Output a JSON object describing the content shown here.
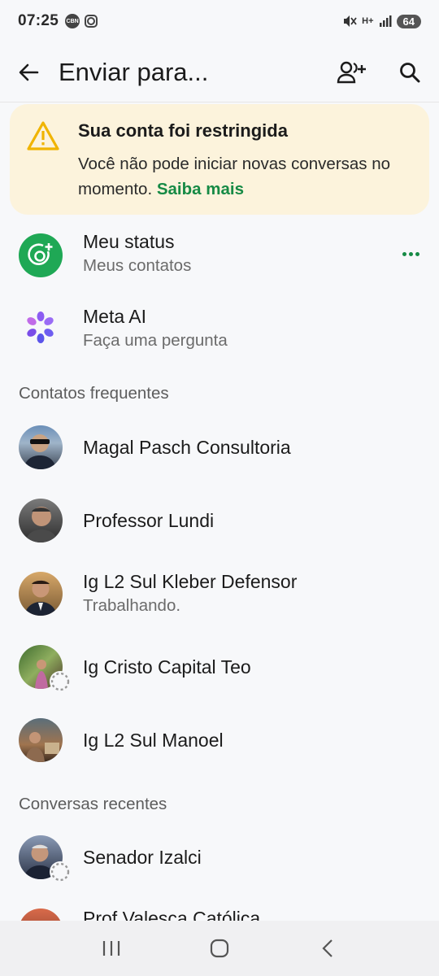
{
  "status_bar": {
    "time": "07:25",
    "notif_icon_1": "CBN",
    "battery": "64",
    "network": "H+"
  },
  "app_bar": {
    "title": "Enviar para..."
  },
  "banner": {
    "title": "Sua conta foi restringida",
    "text": "Você não pode iniciar novas conversas no momento.",
    "link": "Saiba mais"
  },
  "special_rows": [
    {
      "name": "Meu status",
      "sub": "Meus contatos"
    },
    {
      "name": "Meta AI",
      "sub": "Faça uma pergunta"
    }
  ],
  "sections": {
    "frequent": "Contatos frequentes",
    "recent": "Conversas recentes"
  },
  "frequent_contacts": [
    {
      "name": "Magal Pasch Consultoria",
      "sub": ""
    },
    {
      "name": "Professor Lundi",
      "sub": ""
    },
    {
      "name": "Ig L2 Sul Kleber Defensor",
      "sub": "Trabalhando."
    },
    {
      "name": "Ig Cristo Capital Teo",
      "sub": ""
    },
    {
      "name": "Ig L2 Sul Manoel",
      "sub": ""
    }
  ],
  "recent_conversations": [
    {
      "name": "Senador Izalci",
      "sub": ""
    },
    {
      "name": "Prof Valesca Católica",
      "sub": ""
    }
  ],
  "colors": {
    "accent": "#168a45",
    "banner_bg": "#fcf3dc",
    "warning": "#f0b400",
    "status_green": "#1fa855"
  }
}
